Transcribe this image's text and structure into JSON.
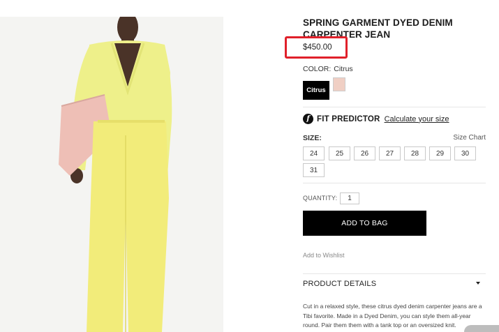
{
  "product": {
    "title": "SPRING GARMENT DYED DENIM CARPENTER JEAN",
    "price": "$450.00",
    "image_icon": "product-photo-model"
  },
  "color": {
    "label": "COLOR:",
    "selected": "Citrus",
    "swatches": [
      {
        "label": "Citrus",
        "color": "#000000"
      },
      {
        "label": "",
        "color": "#f0cfc4"
      }
    ]
  },
  "fit_predictor": {
    "icon": "f-logo-icon",
    "title": "FIT PREDICTOR",
    "link": "Calculate your size"
  },
  "size": {
    "label": "SIZE:",
    "chart_link": "Size Chart",
    "options": [
      "24",
      "25",
      "26",
      "27",
      "28",
      "29",
      "30",
      "31"
    ]
  },
  "quantity": {
    "label": "QUANTITY:",
    "value": "1"
  },
  "add_to_bag": "ADD TO BAG",
  "wishlist": "Add to Wishlist",
  "product_details": {
    "title": "PRODUCT DETAILS",
    "text": "Cut in a relaxed style, these citrus dyed denim carpenter jeans are a Tibi favorite. Made in a Dyed Denim, you can style them all-year round. Pair them them with a tank top or an oversized knit."
  },
  "colors": {
    "highlight": "#e0202a",
    "pants": "#f2ec7a",
    "sweater": "#eef08a",
    "bag": "#eebfb6",
    "skin": "#4a3328"
  }
}
